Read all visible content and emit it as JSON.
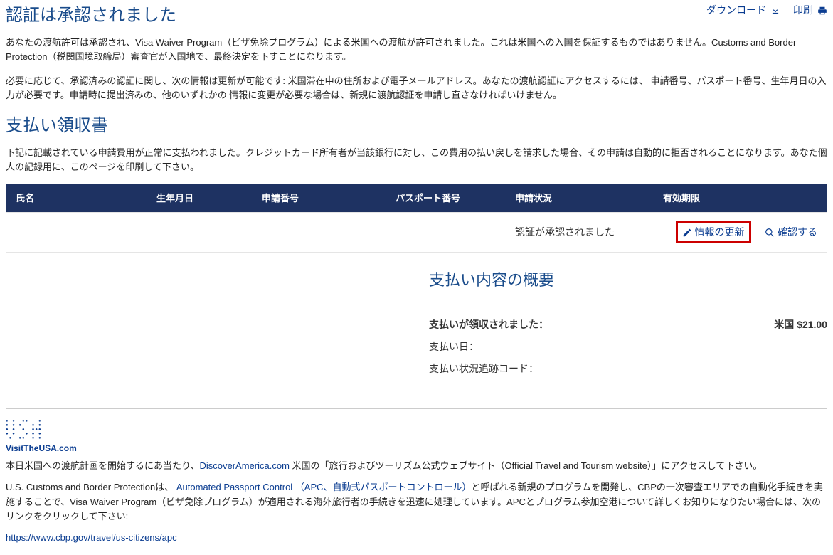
{
  "top": {
    "download": "ダウンロード",
    "print": "印刷"
  },
  "auth": {
    "title": "認証は承認されました",
    "p1": "あなたの渡航許可は承認され、Visa Waiver Program（ビザ免除プログラム）による米国への渡航が許可されました。これは米国への入国を保証するものではありません。Customs and Border Protection（税関国境取締局）審査官が入国地で、最終決定を下すことになります。",
    "p2": "必要に応じて、承認済みの認証に関し、次の情報は更新が可能です: 米国滞在中の住所および電子メールアドレス。あなたの渡航認証にアクセスするには、 申請番号、パスポート番号、生年月日の入力が必要です。申請時に提出済みの、他のいずれかの 情報に変更が必要な場合は、新規に渡航認証を申請し直さなければいけません。"
  },
  "receipt": {
    "title": "支払い領収書",
    "p1": "下記に記載されている申請費用が正常に支払われました。クレジットカード所有者が当該銀行に対し、この費用の払い戻しを請求した場合、その申請は自動的に拒否されることになります。あなた個人の記録用に、このページを印刷して下さい。"
  },
  "table": {
    "h_name": "氏名",
    "h_dob": "生年月日",
    "h_appnum": "申請番号",
    "h_passport": "パスポート番号",
    "h_status": "申請状況",
    "h_expires": "有効期限",
    "row": {
      "name": "",
      "dob": "",
      "appnum": "",
      "passport": "",
      "status": "認証が承認されました",
      "expires": "",
      "update": "情報の更新",
      "confirm": "確認する"
    }
  },
  "summary": {
    "title": "支払い内容の概要",
    "paid_label": "支払いが領収されました：",
    "paid_amount": "米国 $21.00",
    "date_label": "支払い日：",
    "trace_label": "支払い状況追跡コード："
  },
  "footer": {
    "logo_caption": "VisitTheUSA.com",
    "p1a": "本日米国への渡航計画を開始するにあ当たり、",
    "p1link": "DiscoverAmerica.com",
    "p1b": " 米国の「旅行およびツーリズム公式ウェブサイト（Official Travel and Tourism website）」にアクセスして下さい。",
    "p2a": "U.S. Customs and Border Protectionは、 ",
    "p2link": "Automated Passport Control （APC、自動式パスポートコントロール）",
    "p2b": "と呼ばれる新規のプログラムを開発し、CBPの一次審査エリアでの自動化手続きを実施することで、Visa Waiver Program（ビザ免除プログラム）が適用される海外旅行者の手続きを迅速に処理しています。APCとプログラム参加空港について詳しくお知りになりたい場合には、次のリンクをクリックして下さい:",
    "apc_url": "https://www.cbp.gov/travel/us-citizens/apc"
  }
}
